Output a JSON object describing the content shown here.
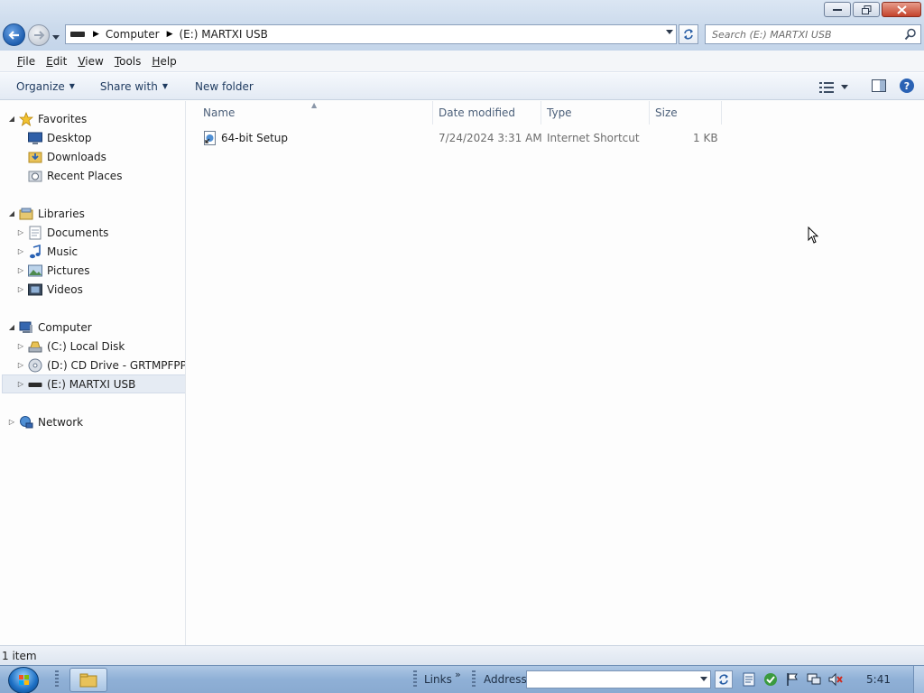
{
  "address_bar": {
    "crumbs": [
      "Computer",
      "(E:) MARTXI USB"
    ]
  },
  "search": {
    "placeholder": "Search (E:) MARTXI USB"
  },
  "menu": {
    "items": [
      {
        "label": "File",
        "underline": "F",
        "rest": "ile"
      },
      {
        "label": "Edit",
        "underline": "E",
        "rest": "dit"
      },
      {
        "label": "View",
        "underline": "V",
        "rest": "iew"
      },
      {
        "label": "Tools",
        "underline": "T",
        "rest": "ools"
      },
      {
        "label": "Help",
        "underline": "H",
        "rest": "elp"
      }
    ]
  },
  "toolbar": {
    "organize": "Organize",
    "share_with": "Share with",
    "new_folder": "New folder"
  },
  "nav": {
    "favorites": "Favorites",
    "desktop": "Desktop",
    "downloads": "Downloads",
    "recent_places": "Recent Places",
    "libraries": "Libraries",
    "documents": "Documents",
    "music": "Music",
    "pictures": "Pictures",
    "videos": "Videos",
    "computer": "Computer",
    "c_drive": "(C:) Local Disk",
    "d_drive": "(D:) CD Drive - GRTMPFPP_EN",
    "e_drive": "(E:) MARTXI USB",
    "network": "Network"
  },
  "columns": {
    "name": "Name",
    "date_modified": "Date modified",
    "type": "Type",
    "size": "Size"
  },
  "files": [
    {
      "name": "64-bit Setup",
      "date_modified": "7/24/2024 3:31 AM",
      "type": "Internet Shortcut",
      "size": "1 KB"
    }
  ],
  "status": {
    "item_count": "1 item"
  },
  "taskbar": {
    "links": "Links",
    "address": "Address",
    "clock": "5:41"
  },
  "colors": {
    "accent": "#1f5fb0",
    "selection": "#e5ebf3",
    "taskbar": "#8fb0d6"
  }
}
